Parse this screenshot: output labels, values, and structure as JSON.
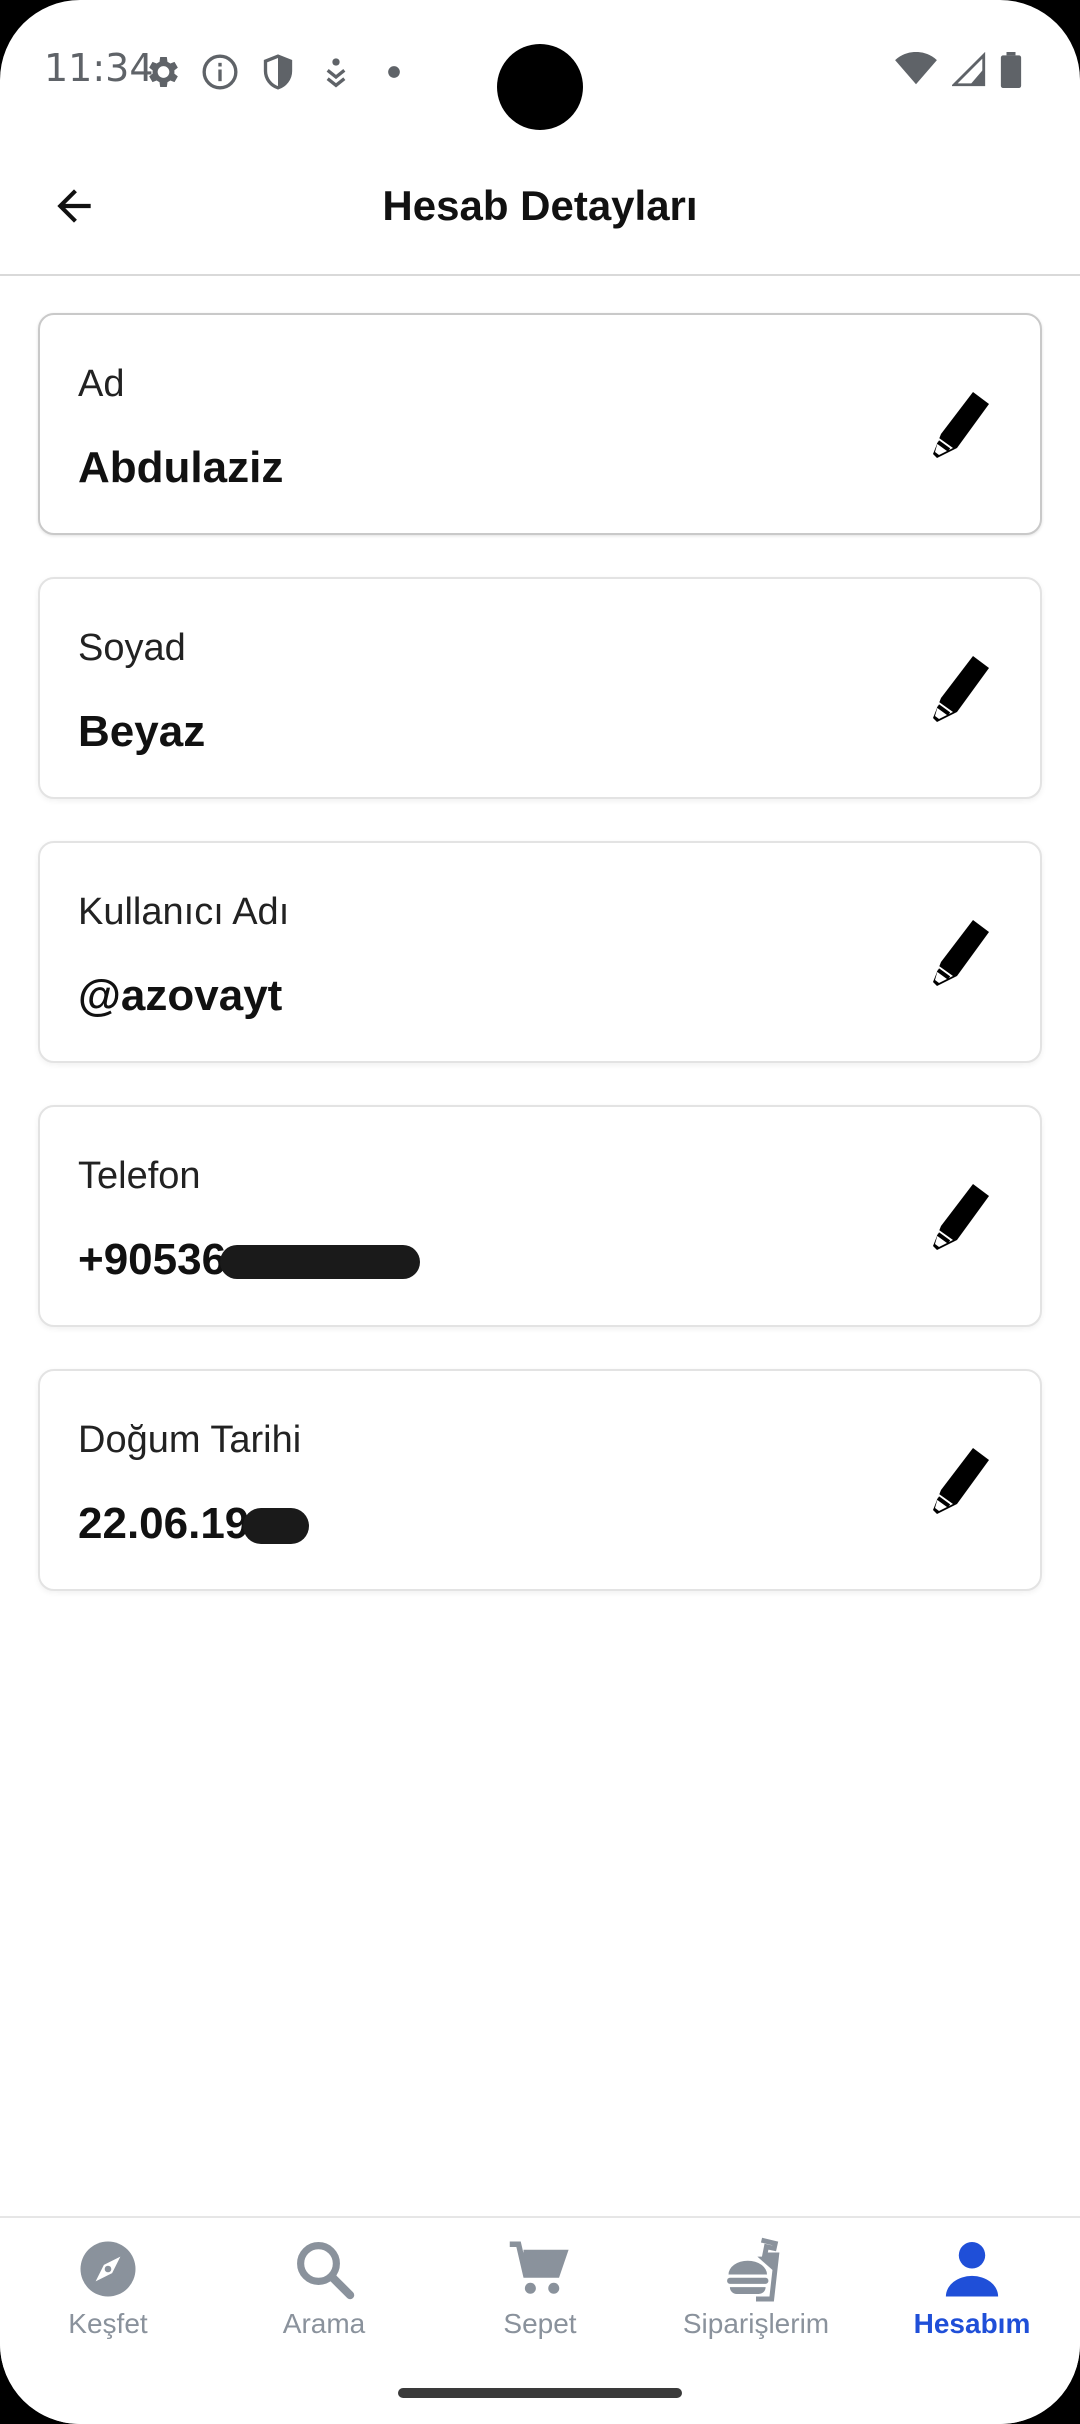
{
  "status_bar": {
    "time": "11:34",
    "left_icons": [
      "settings-icon",
      "info-icon",
      "shield-icon",
      "download-icon",
      "dot-icon"
    ],
    "right_icons": [
      "wifi-icon",
      "signal-icon",
      "battery-icon"
    ]
  },
  "header": {
    "title": "Hesab Detayları",
    "back_icon": "arrow-left-icon"
  },
  "fields": [
    {
      "label": "Ad",
      "value": "Abdulaziz",
      "redacted": false
    },
    {
      "label": "Soyad",
      "value": "Beyaz",
      "redacted": false
    },
    {
      "label": "Kullanıcı Adı",
      "value": "@azovayt",
      "redacted": false
    },
    {
      "label": "Telefon",
      "value": "+90536",
      "redacted": true
    },
    {
      "label": "Doğum Tarihi",
      "value": "22.06.19",
      "redacted": true
    }
  ],
  "edit_icon": "pencil-icon",
  "bottom_nav": {
    "items": [
      {
        "label": "Keşfet",
        "icon": "compass-icon",
        "active": false
      },
      {
        "label": "Arama",
        "icon": "search-icon",
        "active": false
      },
      {
        "label": "Sepet",
        "icon": "cart-icon",
        "active": false
      },
      {
        "label": "Siparişlerim",
        "icon": "takeout-icon",
        "active": false
      },
      {
        "label": "Hesabım",
        "icon": "person-icon",
        "active": true
      }
    ]
  },
  "colors": {
    "active": "#1f4fd8",
    "inactive": "#8a929c",
    "text": "#111111"
  }
}
